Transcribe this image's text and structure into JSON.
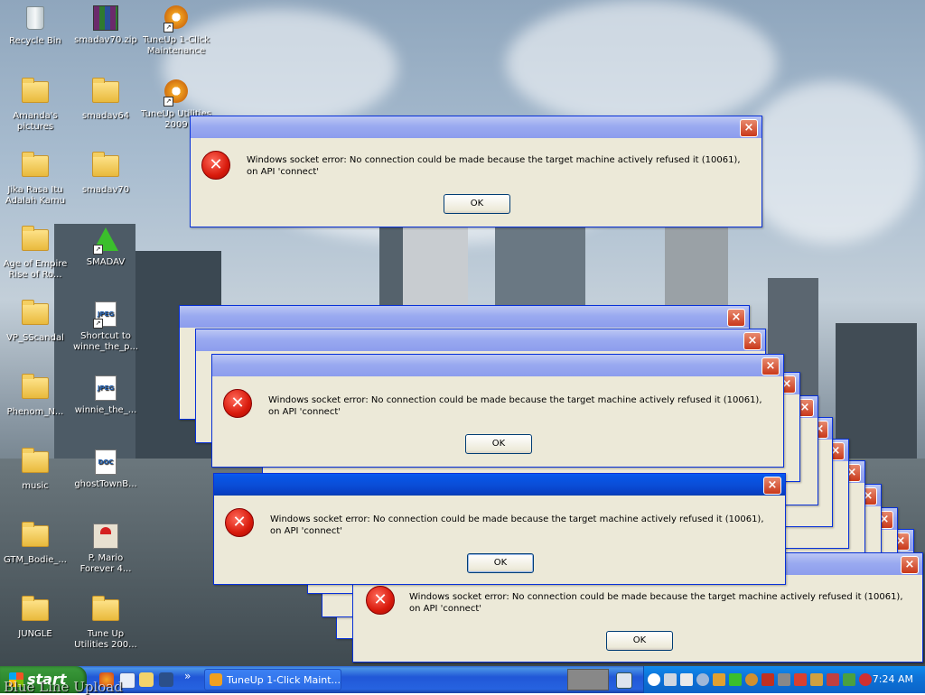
{
  "desktop_icons": [
    {
      "label": "Recycle Bin"
    },
    {
      "label": "smadav70.zip"
    },
    {
      "label": "TuneUp 1-Click Maintenance"
    },
    {
      "label": "Amanda's pictures"
    },
    {
      "label": "smadav64"
    },
    {
      "label": "TuneUp Utilities 2009"
    },
    {
      "label": "Jika Rasa Itu Adalah Kamu"
    },
    {
      "label": "smadav70"
    },
    {
      "label": "Age of Empire Rise of Ro..."
    },
    {
      "label": "SMADAV"
    },
    {
      "label": "VP_SScandal"
    },
    {
      "label": "Shortcut to winne_the_p..."
    },
    {
      "label": "Phenom_N..."
    },
    {
      "label": "winnie_the_..."
    },
    {
      "label": "music"
    },
    {
      "label": "ghostTownB..."
    },
    {
      "label": "GTM_Bodie_..."
    },
    {
      "label": "P. Mario Forever 4..."
    },
    {
      "label": "JUNGLE"
    },
    {
      "label": "Tune Up Utilities 200..."
    }
  ],
  "dialog": {
    "message": "Windows socket error: No connection could be made because the target machine actively refused it (10061), on API 'connect'",
    "ok_label": "OK",
    "close_glyph": "×",
    "error_glyph": "✕"
  },
  "taskbar": {
    "start_label": "start",
    "task_item_label": "TuneUp 1-Click Maint...",
    "overflow_glyph": "»",
    "clock": "7:24 AM",
    "watermark": "Blue Line Upload"
  },
  "colors": {
    "titlebar_active": "#0a4ed8",
    "titlebar_inactive": "#9aaaf0",
    "dialog_bg": "#ece9d8",
    "error_red": "#d81a0c",
    "start_green": "#2f8a2f"
  }
}
